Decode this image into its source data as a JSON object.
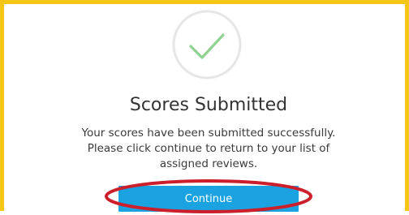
{
  "dialog": {
    "title": "Scores Submitted",
    "message": "Your scores have been submitted successfully. Please click continue to return to your list of assigned reviews.",
    "continue_label": "Continue"
  },
  "colors": {
    "frame_border": "#f5c518",
    "check_color": "#8fd28f",
    "check_circle": "#e6e6e6",
    "button_bg": "#1aa3e0",
    "highlight_oval": "#cc1f2b"
  },
  "icons": {
    "success": "check-icon"
  }
}
